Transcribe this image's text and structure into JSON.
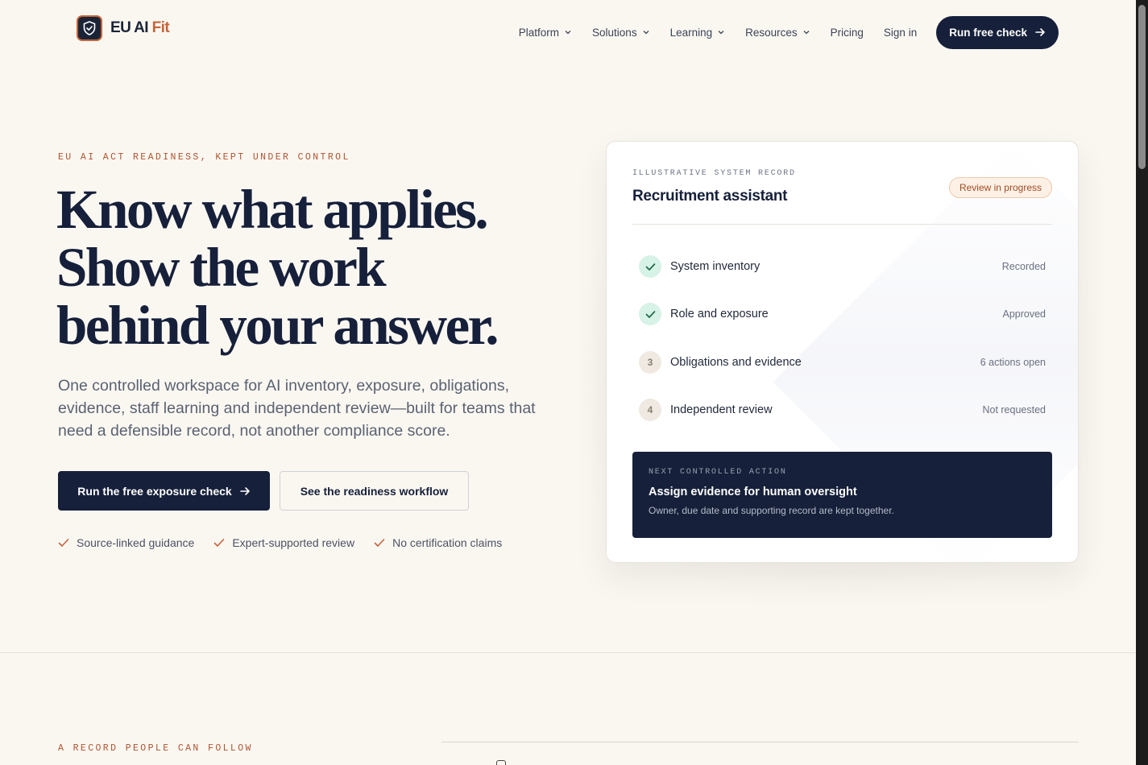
{
  "brand": {
    "name_main": "EU AI",
    "name_accent": "Fit",
    "accent_color": "#c4653a",
    "primary_color": "#16203a"
  },
  "nav": {
    "items": [
      {
        "label": "Platform",
        "has_dropdown": true
      },
      {
        "label": "Solutions",
        "has_dropdown": true
      },
      {
        "label": "Learning",
        "has_dropdown": true
      },
      {
        "label": "Resources",
        "has_dropdown": true
      },
      {
        "label": "Pricing",
        "has_dropdown": false
      },
      {
        "label": "Sign in",
        "has_dropdown": false
      }
    ],
    "cta_label": "Run free check"
  },
  "hero": {
    "eyebrow": "EU AI ACT READINESS, KEPT UNDER CONTROL",
    "title_lines": [
      "Know what applies.",
      "Show the work",
      "behind your answer."
    ],
    "subtitle": "One controlled workspace for AI inventory, exposure, obligations, evidence, staff learning and independent review—built for teams that need a defensible record, not another compliance score.",
    "primary_button": "Run the free exposure check",
    "secondary_button": "See the readiness workflow",
    "trust_points": [
      "Source-linked guidance",
      "Expert-supported review",
      "No certification claims"
    ]
  },
  "record_card": {
    "label": "ILLUSTRATIVE SYSTEM RECORD",
    "title": "Recruitment assistant",
    "badge": "Review in progress",
    "steps": [
      {
        "marker": "",
        "done": true,
        "label": "System inventory",
        "status": "Recorded"
      },
      {
        "marker": "",
        "done": true,
        "label": "Role and exposure",
        "status": "Approved"
      },
      {
        "marker": "3",
        "done": false,
        "label": "Obligations and evidence",
        "status": "6 actions open"
      },
      {
        "marker": "4",
        "done": false,
        "label": "Independent review",
        "status": "Not requested"
      }
    ],
    "next_action": {
      "label": "NEXT CONTROLLED ACTION",
      "title": "Assign evidence for human oversight",
      "description": "Owner, due date and supporting record are kept together."
    }
  },
  "lower_section": {
    "eyebrow": "A RECORD PEOPLE CAN FOLLOW"
  }
}
